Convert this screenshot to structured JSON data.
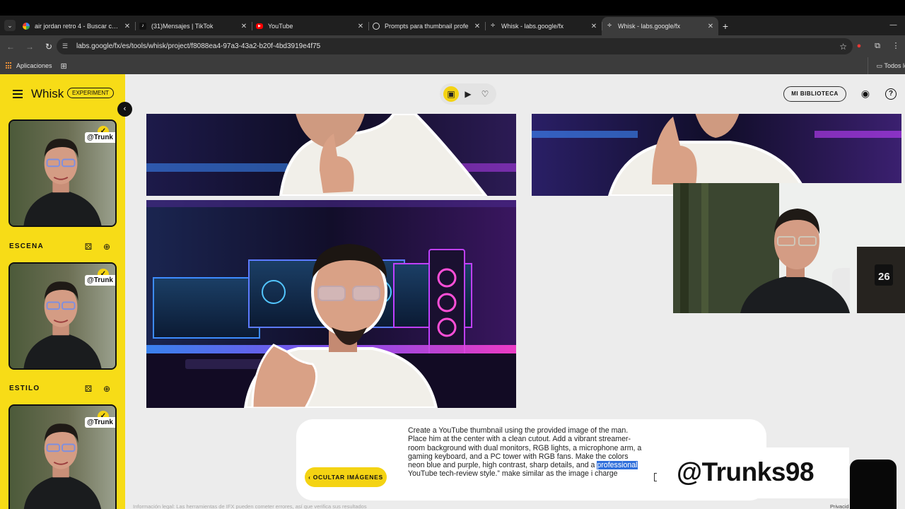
{
  "browser": {
    "tabs": [
      {
        "title": "air jordan retro 4 - Buscar con G",
        "icon": "google-icon",
        "active": false
      },
      {
        "title": "(31)Mensajes | TikTok",
        "icon": "tiktok-icon",
        "active": false
      },
      {
        "title": "YouTube",
        "icon": "youtube-icon",
        "active": false
      },
      {
        "title": "Prompts para thumbnail profe",
        "icon": "chatgpt-icon",
        "active": false
      },
      {
        "title": "Whisk - labs.google/fx",
        "icon": "whisk-icon",
        "active": false
      },
      {
        "title": "Whisk - labs.google/fx",
        "icon": "whisk-icon",
        "active": true
      }
    ],
    "new_tab": "+",
    "url": "labs.google/fx/es/tools/whisk/project/f8088ea4-97a3-43a2-b20f-4bd3919e4f75",
    "bookmarks": {
      "apps_label": "Aplicaciones",
      "all_label": "Todos lo"
    }
  },
  "app": {
    "brand": "Whisk",
    "badge": "EXPERIMENT",
    "sections": {
      "scene": "ESCENA",
      "style": "ESTILO"
    },
    "library_button": "MI BIBLIOTECA",
    "subject_tag": "@Trunk",
    "hide_images_button": "OCULTAR IMÁGENES",
    "prompt_before": "Create a YouTube thumbnail using the provided image of the man. Place him at the center with a clean cutout. Add a vibrant streamer-room background with dual monitors, RGB lights, a microphone arm, a gaming keyboard, and a PC tower with RGB fans. Make the colors neon blue and purple, high contrast, sharp details, and a ",
    "prompt_highlight": "professional",
    "prompt_after": " YouTube tech-review style.” make similar as the image i charge",
    "footer_left": "Información legal: Las herramientas de IFX pueden cometer errores, así que verifica sus resultados",
    "footer_right": "Privacid"
  },
  "overlay": {
    "handle": "@Trunks98"
  },
  "colors": {
    "accent": "#f4d313",
    "sidebar": "#f7dc17",
    "neon_blue": "#3d8cff",
    "neon_purple": "#c040ff"
  }
}
